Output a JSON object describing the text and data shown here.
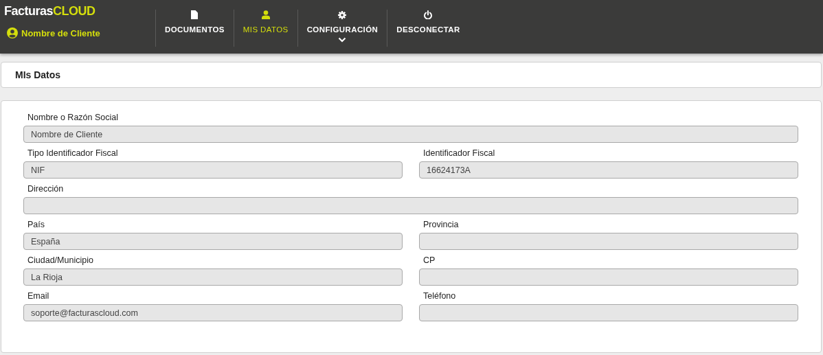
{
  "brand": {
    "name": "Facturas",
    "highlight": "CLOUD"
  },
  "user": {
    "name": "Nombre de Cliente"
  },
  "nav": [
    {
      "label": "DOCUMENTOS",
      "kind": "document",
      "selected": false,
      "dropdown": false
    },
    {
      "label": "MIS DATOS",
      "kind": "user",
      "selected": true,
      "dropdown": false
    },
    {
      "label": "CONFIGURACIÓN",
      "kind": "gear",
      "selected": false,
      "dropdown": true
    },
    {
      "label": "DESCONECTAR",
      "kind": "power",
      "selected": false,
      "dropdown": false
    }
  ],
  "page_title": "MIs Datos",
  "form": [
    [
      {
        "label": "Nombre o Razón Social",
        "value": "Nombre de Cliente"
      }
    ],
    [
      {
        "label": "Tipo Identificador Fiscal",
        "value": "NIF"
      },
      {
        "label": "Identificador Fiscal",
        "value": "16624173A"
      }
    ],
    [
      {
        "label": "Dirección"
      }
    ],
    [
      {
        "label": "País",
        "value": "España"
      },
      {
        "label": "Provincia"
      }
    ],
    [
      {
        "label": "Ciudad/Municipio",
        "value": "La Rioja"
      },
      {
        "label": "CP"
      }
    ],
    [
      {
        "label": "Email",
        "value": "soporte@facturascloud.com"
      },
      {
        "label": "Teléfono"
      }
    ]
  ]
}
